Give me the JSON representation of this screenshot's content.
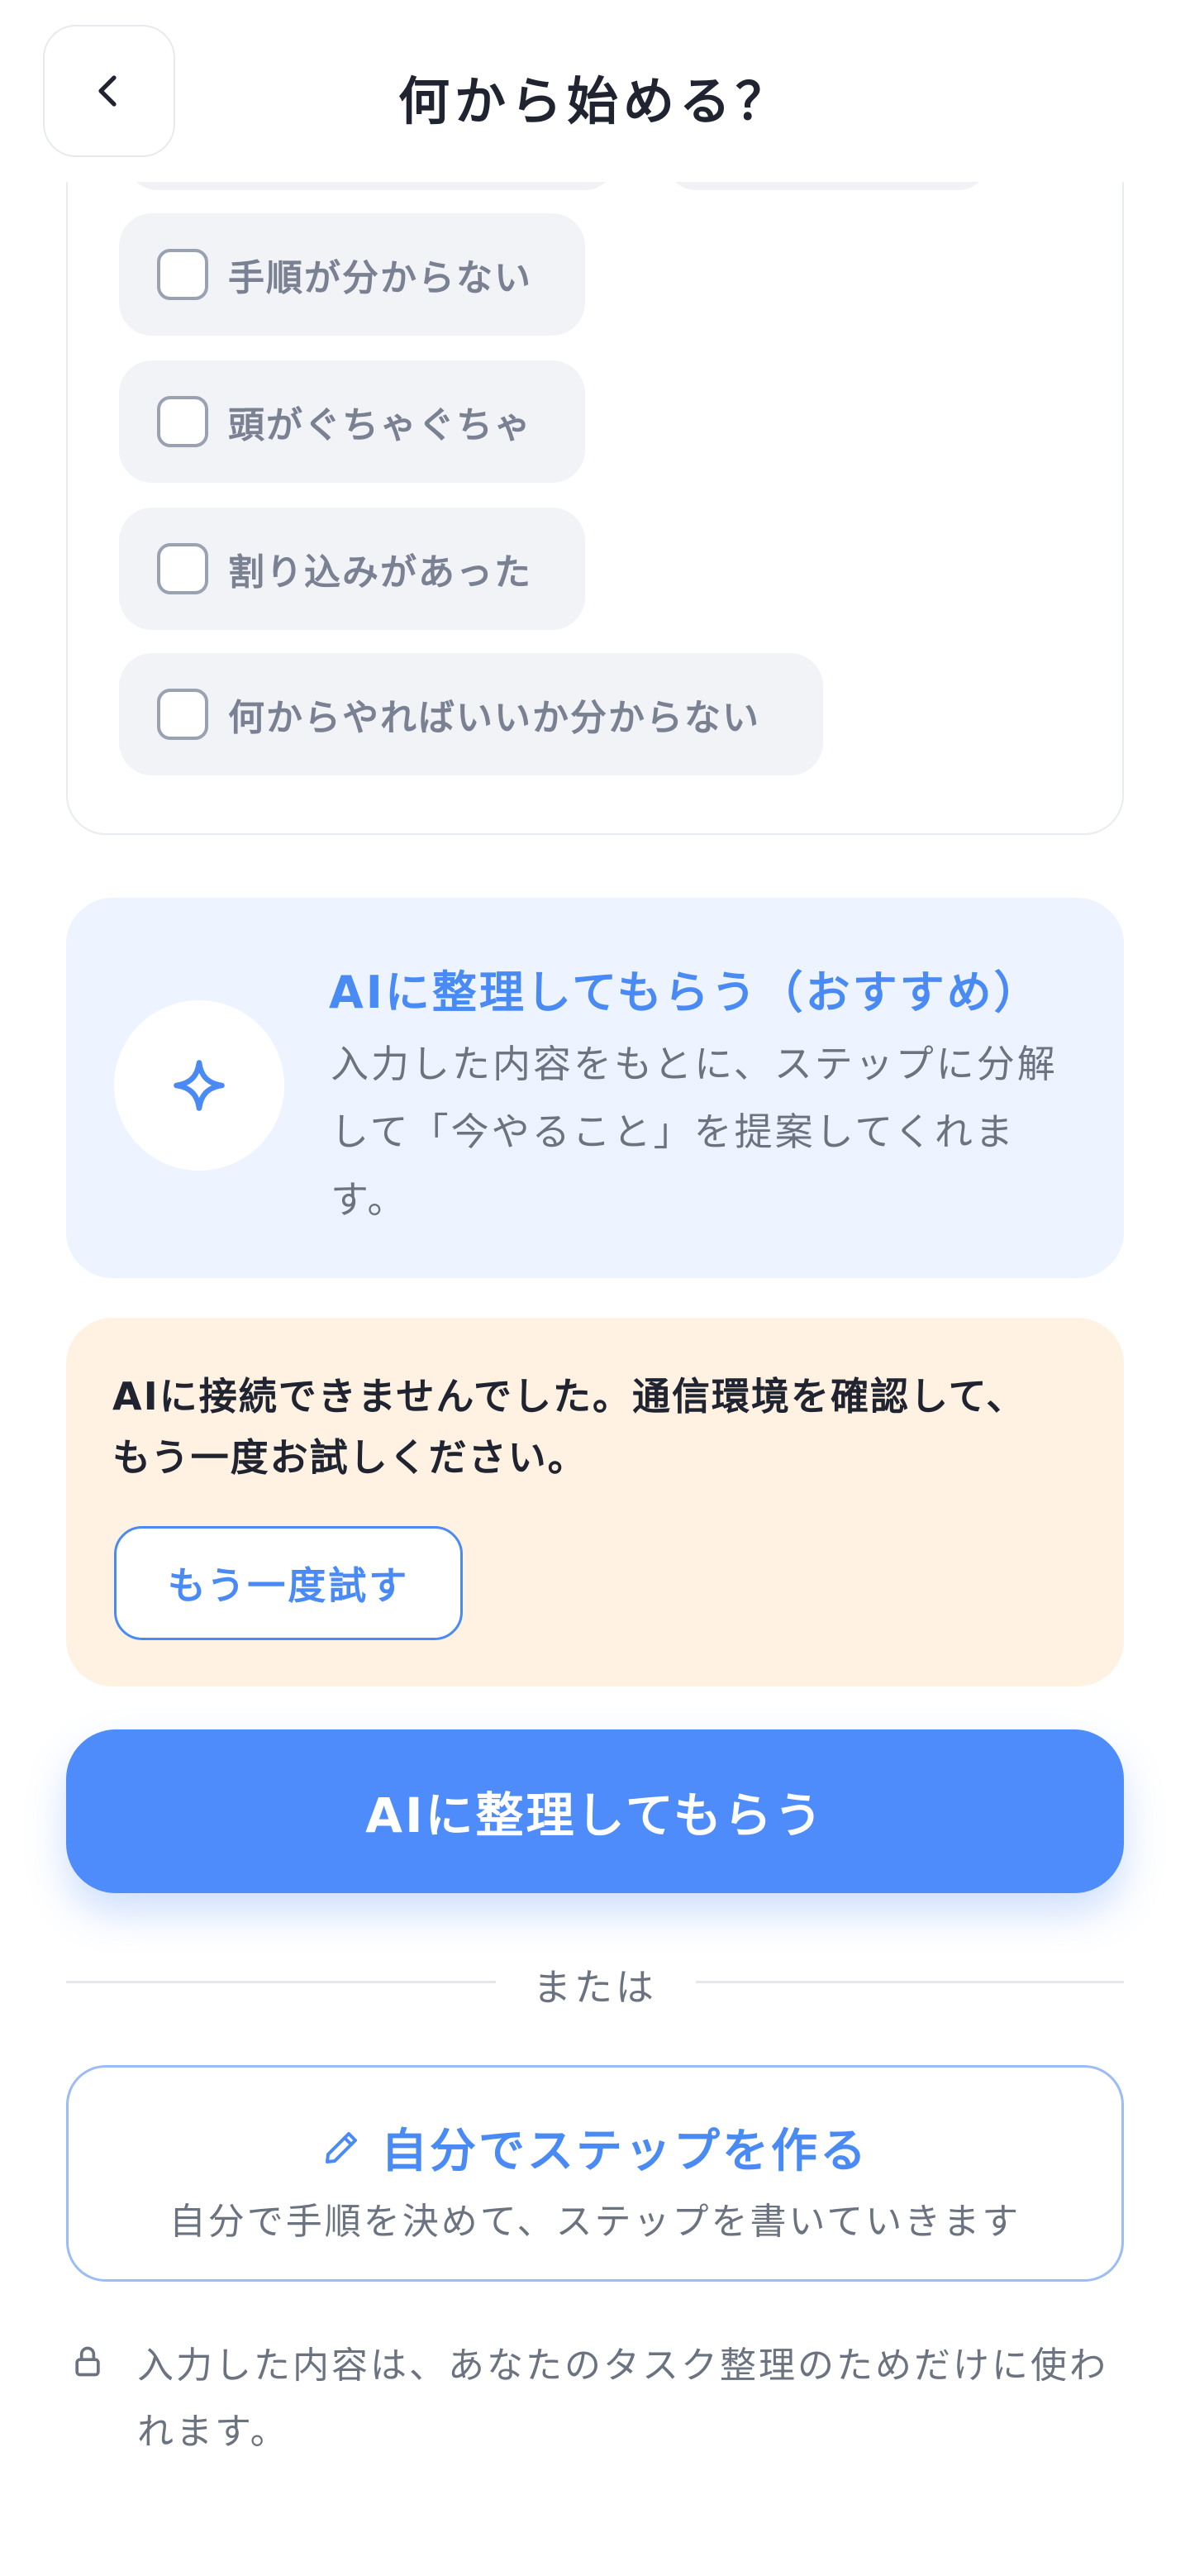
{
  "header": {
    "title": "何から始める？"
  },
  "options": [
    {
      "label": "手順が分からない",
      "checked": false
    },
    {
      "label": "頭がぐちゃぐちゃ",
      "checked": false
    },
    {
      "label": "割り込みがあった",
      "checked": false
    },
    {
      "label": "何からやればいいか分からない",
      "checked": false
    }
  ],
  "ai_card": {
    "title": "AIに整理してもらう（おすすめ）",
    "description": "入力した内容をもとに、ステップに分解して「今やること」を提案してくれます。",
    "icon": "sparkle-icon"
  },
  "error": {
    "message": "AIに接続できませんでした。通信環境を確認して、もう一度お試しください。",
    "retry_label": "もう一度試す"
  },
  "primary_button": {
    "label": "AIに整理してもらう"
  },
  "divider": {
    "label": "または"
  },
  "secondary_button": {
    "title": "自分でステップを作る",
    "subtitle": "自分で手順を決めて、ステップを書いていきます",
    "icon": "pencil-icon"
  },
  "privacy": {
    "text": "入力した内容は、あなたのタスク整理のためだけに使われます。",
    "icon": "lock-icon"
  },
  "colors": {
    "accent": "#4f8cfb",
    "accent_text": "#4a8af4",
    "ai_card_bg": "#edf4ff",
    "error_bg": "#fff2e2"
  }
}
